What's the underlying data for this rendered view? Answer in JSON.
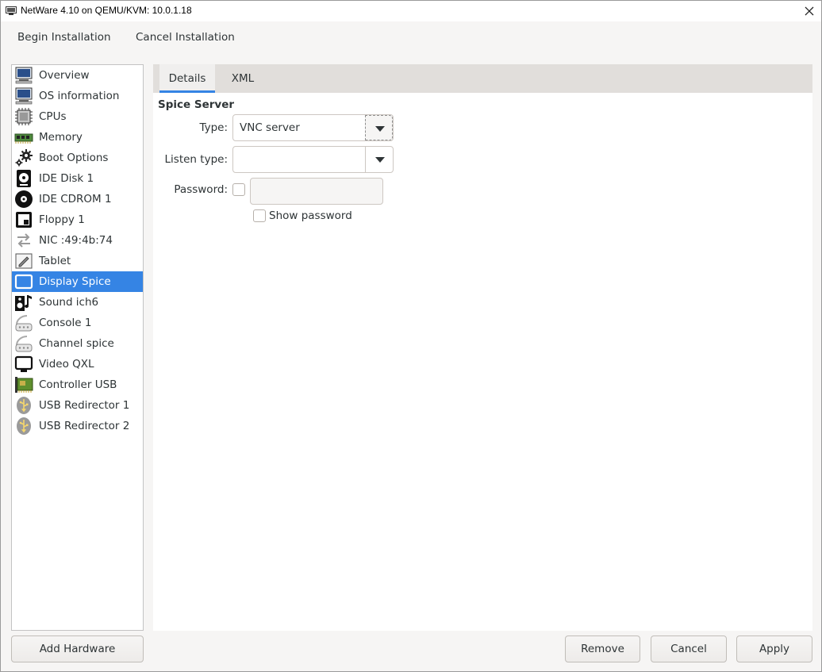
{
  "window": {
    "title": "NetWare 4.10 on QEMU/KVM: 10.0.1.18"
  },
  "menubar": {
    "begin_installation": "Begin Installation",
    "cancel_installation": "Cancel Installation"
  },
  "sidebar": {
    "items": [
      {
        "label": "Overview",
        "icon": "monitor-icon"
      },
      {
        "label": "OS information",
        "icon": "monitor-icon"
      },
      {
        "label": "CPUs",
        "icon": "cpu-icon"
      },
      {
        "label": "Memory",
        "icon": "memory-icon"
      },
      {
        "label": "Boot Options",
        "icon": "gears-icon"
      },
      {
        "label": "IDE Disk 1",
        "icon": "disk-icon"
      },
      {
        "label": "IDE CDROM 1",
        "icon": "cdrom-icon"
      },
      {
        "label": "Floppy 1",
        "icon": "floppy-icon"
      },
      {
        "label": "NIC :49:4b:74",
        "icon": "network-arrows-icon"
      },
      {
        "label": "Tablet",
        "icon": "tablet-icon"
      },
      {
        "label": "Display Spice",
        "icon": "display-icon",
        "selected": true
      },
      {
        "label": "Sound ich6",
        "icon": "sound-icon"
      },
      {
        "label": "Console 1",
        "icon": "serial-icon"
      },
      {
        "label": "Channel spice",
        "icon": "serial-icon"
      },
      {
        "label": "Video QXL",
        "icon": "video-icon"
      },
      {
        "label": "Controller USB",
        "icon": "controller-icon"
      },
      {
        "label": "USB Redirector 1",
        "icon": "usb-icon"
      },
      {
        "label": "USB Redirector 2",
        "icon": "usb-icon"
      }
    ],
    "add_hardware": "Add Hardware"
  },
  "tabs": {
    "details": "Details",
    "xml": "XML"
  },
  "form": {
    "section_title": "Spice Server",
    "type_label": "Type:",
    "type_value": "VNC server",
    "listen_type_label": "Listen type:",
    "listen_type_value": "",
    "password_label": "Password:",
    "password_value": "",
    "show_password_label": "Show password"
  },
  "footer": {
    "remove": "Remove",
    "cancel": "Cancel",
    "apply": "Apply"
  },
  "colors": {
    "accent": "#3584e4",
    "tab_bar": "#e1dedb",
    "window_bg": "#f6f5f4"
  }
}
